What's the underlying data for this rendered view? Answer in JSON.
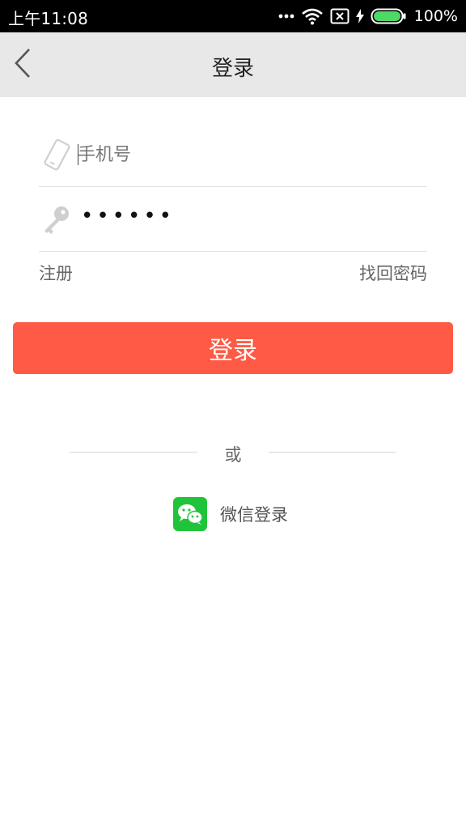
{
  "status_bar": {
    "time": "上午11:08",
    "battery": "100%",
    "icons": [
      "more-dots-icon",
      "wifi-icon",
      "no-sim-icon",
      "charging-bolt-icon",
      "battery-icon"
    ]
  },
  "header": {
    "back_icon": "chevron-left-icon",
    "title": "登录"
  },
  "form": {
    "phone": {
      "icon": "phone-icon",
      "placeholder": "手机号",
      "value": ""
    },
    "password": {
      "icon": "key-icon",
      "masked_value": "••••••"
    },
    "register_label": "注册",
    "recover_label": "找回密码",
    "login_label": "登录"
  },
  "alt_login": {
    "divider_text": "或",
    "wechat_icon": "wechat-icon",
    "wechat_label": "微信登录"
  },
  "colors": {
    "accent": "#ff5a45",
    "wechat_green": "#1fc43a",
    "header_bg": "#e8e8e8"
  }
}
